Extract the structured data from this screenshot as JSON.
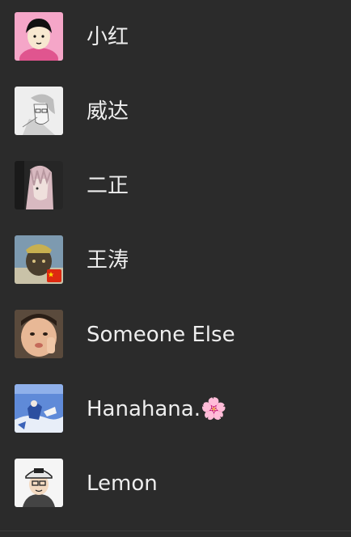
{
  "contacts": [
    {
      "name": "小红",
      "avatar_icon": "manga-boy-avatar-icon",
      "avatar_bg": "#f5a6c8"
    },
    {
      "name": "威达",
      "avatar_icon": "sketch-portrait-avatar-icon",
      "avatar_bg": "#e8e8e8"
    },
    {
      "name": "二正",
      "avatar_icon": "anime-girl-avatar-icon",
      "avatar_bg": "#2a2a2a"
    },
    {
      "name": "王涛",
      "avatar_icon": "statue-flag-avatar-icon",
      "avatar_bg": "#6f8fa8"
    },
    {
      "name": "Someone Else",
      "avatar_icon": "child-photo-avatar-icon",
      "avatar_bg": "#6b5848"
    },
    {
      "name": "Hanahana.🌸",
      "avatar_icon": "blue-painting-avatar-icon",
      "avatar_bg": "#5b86d6"
    },
    {
      "name": "Lemon",
      "avatar_icon": "cartoon-cap-avatar-icon",
      "avatar_bg": "#f4f4f4"
    }
  ]
}
